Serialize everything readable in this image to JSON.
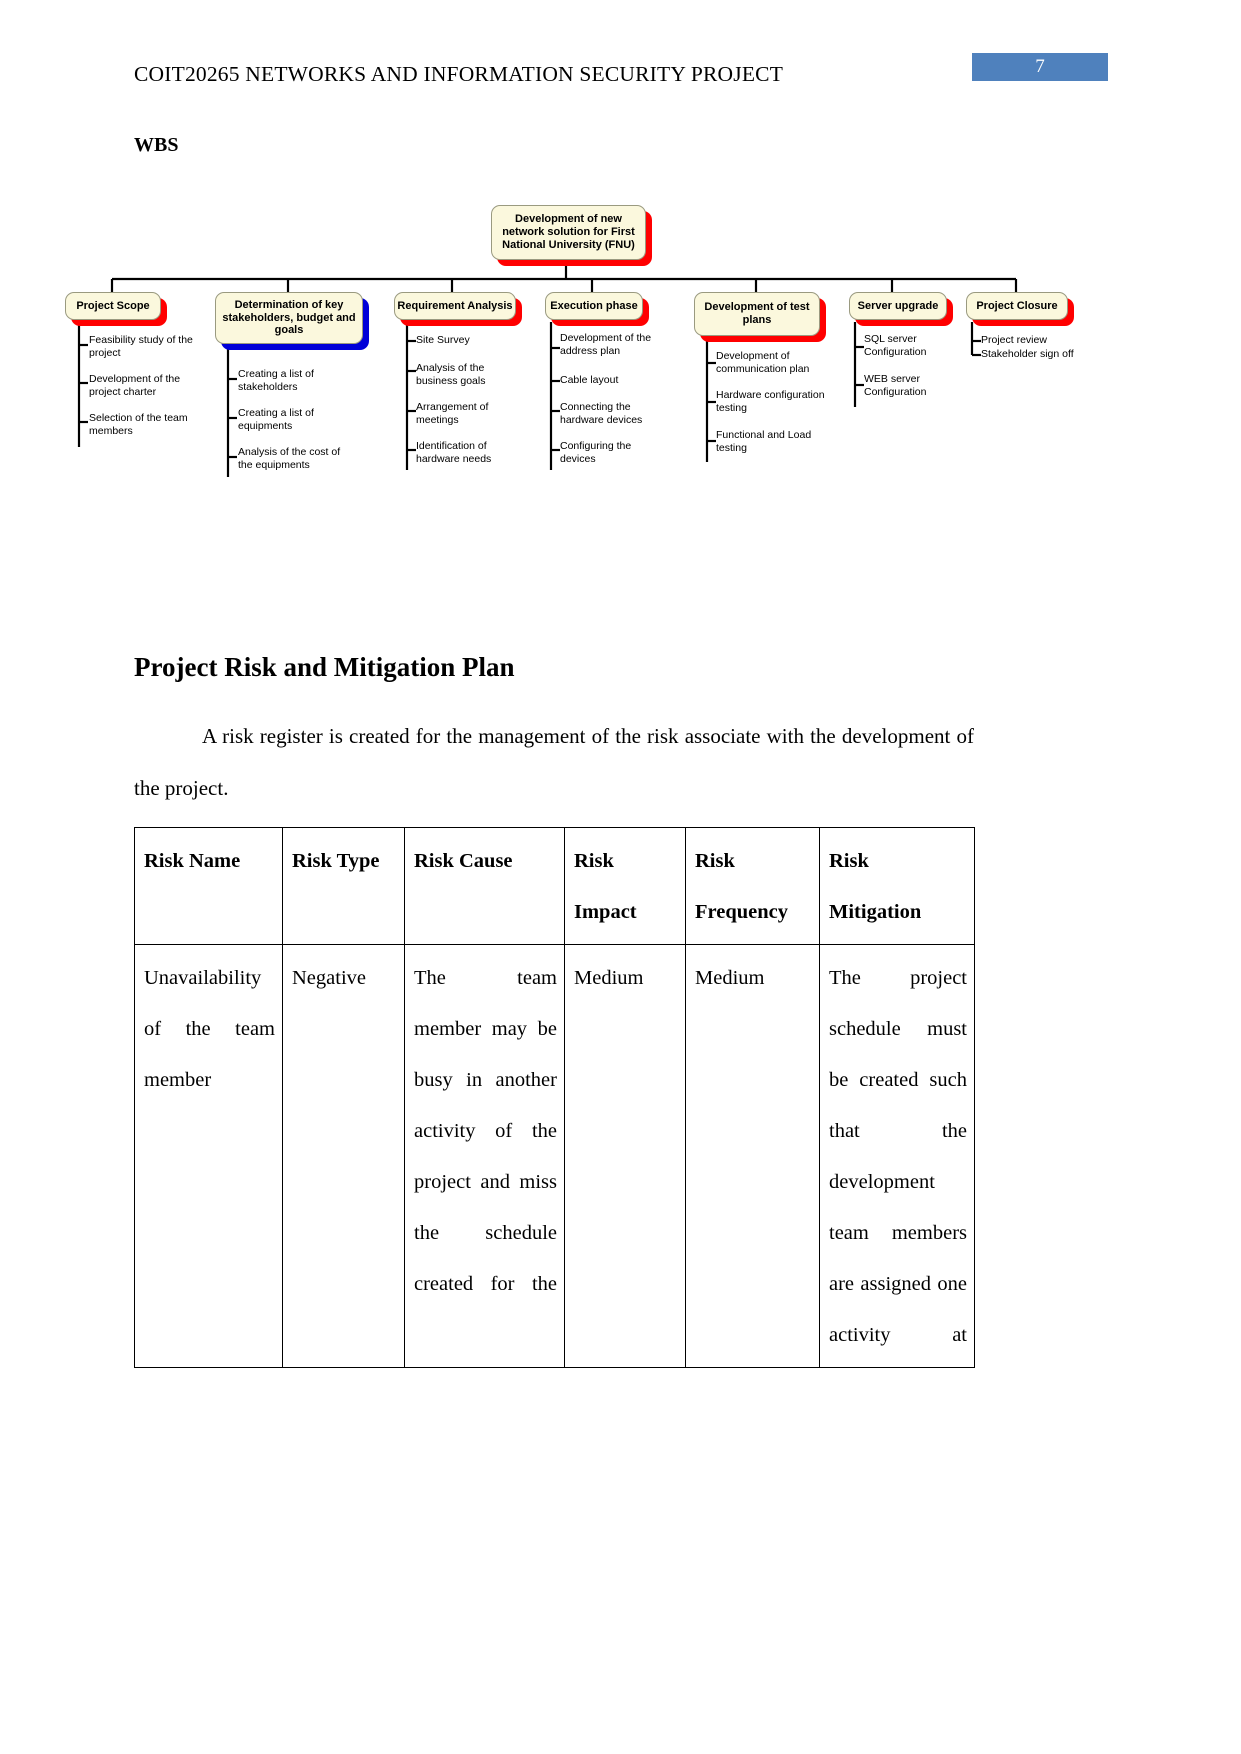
{
  "header": {
    "title": "COIT20265 NETWORKS AND INFORMATION SECURITY PROJECT",
    "page_number": "7",
    "badge_color": "#4F81BD"
  },
  "sections": {
    "wbs_label": "WBS",
    "risk_heading": "Project Risk and Mitigation Plan",
    "risk_intro": "A risk register is created for the management of the risk associate with the development of the project."
  },
  "wbs": {
    "root": {
      "label": "Development of new network solution for First National University (FNU)",
      "shadow_color": "#FF0000"
    },
    "branches": [
      {
        "label": "Project Scope",
        "shadow_color": "#FF0000",
        "items": [
          "Feasibility study of the project",
          "Development of the project charter",
          "Selection of the team members"
        ]
      },
      {
        "label": "Determination of key stakeholders, budget and goals",
        "shadow_color": "#0000D8",
        "items": [
          "Creating a list of stakeholders",
          "Creating a list of equipments",
          "Analysis of the cost of the equipments"
        ]
      },
      {
        "label": "Requirement Analysis",
        "shadow_color": "#FF0000",
        "items": [
          "Site Survey",
          "Analysis of the business goals",
          "Arrangement of meetings",
          "Identification of hardware needs"
        ]
      },
      {
        "label": "Execution phase",
        "shadow_color": "#FF0000",
        "items": [
          "Development of the address plan",
          "Cable layout",
          "Connecting the hardware devices",
          "Configuring the devices"
        ]
      },
      {
        "label": "Development of test plans",
        "shadow_color": "#FF0000",
        "items": [
          "Development of communication plan",
          "Hardware configuration testing",
          "Functional and Load testing"
        ]
      },
      {
        "label": "Server upgrade",
        "shadow_color": "#FF0000",
        "items": [
          "SQL server Configuration",
          "WEB server Configuration"
        ]
      },
      {
        "label": "Project Closure",
        "shadow_color": "#FF0000",
        "items": [
          "Project review",
          "Stakeholder sign off"
        ]
      }
    ]
  },
  "risk_table": {
    "headers": [
      "Risk Name",
      "Risk Type",
      "Risk Cause",
      "Risk Impact",
      "Risk Frequency",
      "Risk Mitigation"
    ],
    "header_lines": {
      "risk_impact_l1": "Risk",
      "risk_impact_l2": "Impact",
      "risk_frequency_l1": "Risk",
      "risk_frequency_l2": "Frequency",
      "risk_mitigation_l1": "Risk",
      "risk_mitigation_l2": "Mitigation"
    },
    "rows": [
      {
        "name": "Unavailability of the team member",
        "type": "Negative",
        "cause": "The team member may be busy in another activity of the project and miss the schedule created for the",
        "impact": "Medium",
        "frequency": "Medium",
        "mitigation": "The project schedule must be created such that the development team members are assigned one activity at"
      }
    ]
  }
}
